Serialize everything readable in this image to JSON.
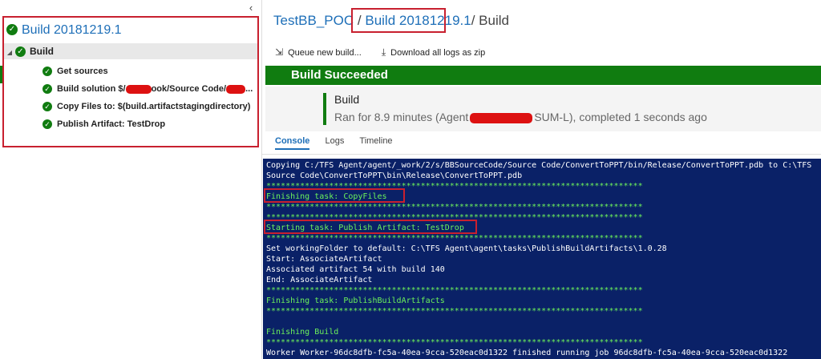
{
  "left_panel": {
    "collapse_glyph": "‹",
    "build_title": "Build 20181219.1",
    "build_node": "Build",
    "tasks": [
      {
        "label": "Get sources"
      },
      {
        "prefix": "Build solution $/",
        "middle": "ook/Source Code/",
        "suffix": "..."
      },
      {
        "label": "Copy Files to: $(build.artifactstagingdirectory)"
      },
      {
        "label": "Publish Artifact: TestDrop"
      }
    ]
  },
  "header": {
    "project": "TestBB_POC",
    "separator": "/",
    "build": "Build 20181219.1",
    "current": "/ Build"
  },
  "toolbar": {
    "queue_label": "Queue new build...",
    "download_label": "Download all logs as zip"
  },
  "status": {
    "text": "Build Succeeded"
  },
  "job": {
    "name": "Build",
    "desc_prefix": "Ran for 8.9 minutes (Agent",
    "desc_suffix": "SUM-L), completed 1 seconds ago"
  },
  "tabs": [
    {
      "label": "Console",
      "active": true
    },
    {
      "label": "Logs",
      "active": false
    },
    {
      "label": "Timeline",
      "active": false
    }
  ],
  "console_lines": [
    {
      "text": "Copying C:/TFS Agent/agent/_work/2/s/BBSourceCode/Source Code/ConvertToPPT/bin/Release/ConvertToPPT.pdb to C:\\TFS",
      "color": "w"
    },
    {
      "text": "Source Code\\ConvertToPPT\\bin\\Release\\ConvertToPPT.pdb",
      "color": "w"
    },
    {
      "text": "******************************************************************************",
      "color": "g"
    },
    {
      "text": "Finishing task: CopyFiles",
      "color": "g"
    },
    {
      "text": "******************************************************************************",
      "color": "g"
    },
    {
      "text": "******************************************************************************",
      "color": "g"
    },
    {
      "text": "Starting task: Publish Artifact: TestDrop",
      "color": "g"
    },
    {
      "text": "******************************************************************************",
      "color": "g"
    },
    {
      "text": "Set workingFolder to default: C:\\TFS Agent\\agent\\tasks\\PublishBuildArtifacts\\1.0.28",
      "color": "w"
    },
    {
      "text": "Start: AssociateArtifact",
      "color": "w"
    },
    {
      "text": "Associated artifact 54 with build 140",
      "color": "w"
    },
    {
      "text": "End: AssociateArtifact",
      "color": "w"
    },
    {
      "text": "******************************************************************************",
      "color": "g"
    },
    {
      "text": "Finishing task: PublishBuildArtifacts",
      "color": "g"
    },
    {
      "text": "******************************************************************************",
      "color": "g"
    },
    {
      "text": "",
      "color": "w"
    },
    {
      "text": "Finishing Build",
      "color": "g"
    },
    {
      "text": "******************************************************************************",
      "color": "g"
    },
    {
      "text": "Worker Worker-96dc8dfb-fc5a-40ea-9cca-520eac0d1322 finished running job 96dc8dfb-fc5a-40ea-9cca-520eac0d1322",
      "color": "w"
    }
  ],
  "colors": {
    "success_green": "#107c10",
    "link_blue": "#1e6fb8",
    "annotation_red": "#c8202f",
    "console_bg": "#0a2167",
    "console_green": "#6cf25b",
    "redaction_red": "#dd1111"
  }
}
